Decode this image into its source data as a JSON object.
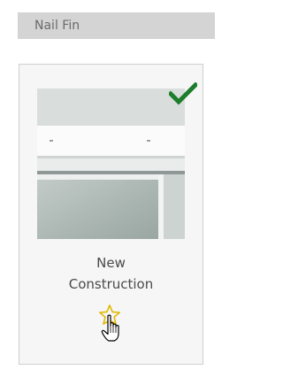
{
  "section": {
    "title": "Nail Fin"
  },
  "card": {
    "caption_line1": "New",
    "caption_line2": "Construction",
    "selected": true,
    "favorite": false,
    "thumbnail_alt": "window-frame-photo",
    "check_icon": "checkmark-icon",
    "star_icon": "star-outline-icon"
  },
  "colors": {
    "header_bg": "#d4d4d4",
    "check_green": "#1e7d2c",
    "star_outline": "#e0b800",
    "card_border": "#cfcfcf"
  }
}
